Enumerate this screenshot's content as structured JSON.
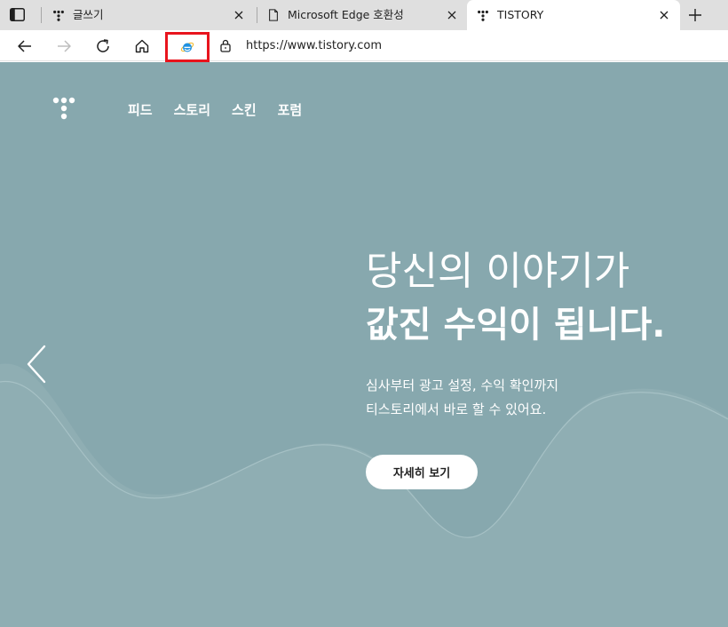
{
  "tabs": [
    {
      "title": "글쓰기",
      "favicon": "tistory-icon"
    },
    {
      "title": "Microsoft Edge 호환성",
      "favicon": "page-icon"
    },
    {
      "title": "TISTORY",
      "favicon": "tistory-icon",
      "active": true
    }
  ],
  "toolbar": {
    "url": "https://www.tistory.com",
    "ie_mode_highlight_color": "#e8141d"
  },
  "page": {
    "nav": [
      "피드",
      "스토리",
      "스킨",
      "포럼"
    ],
    "hero": {
      "line1": "당신의 이야기가",
      "line2": "값진 수익이 됩니다.",
      "desc1": "심사부터 광고 설정, 수익 확인까지",
      "desc2": "티스토리에서 바로 할 수 있어요.",
      "cta": "자세히 보기"
    },
    "background_color": "#87a8ae"
  }
}
